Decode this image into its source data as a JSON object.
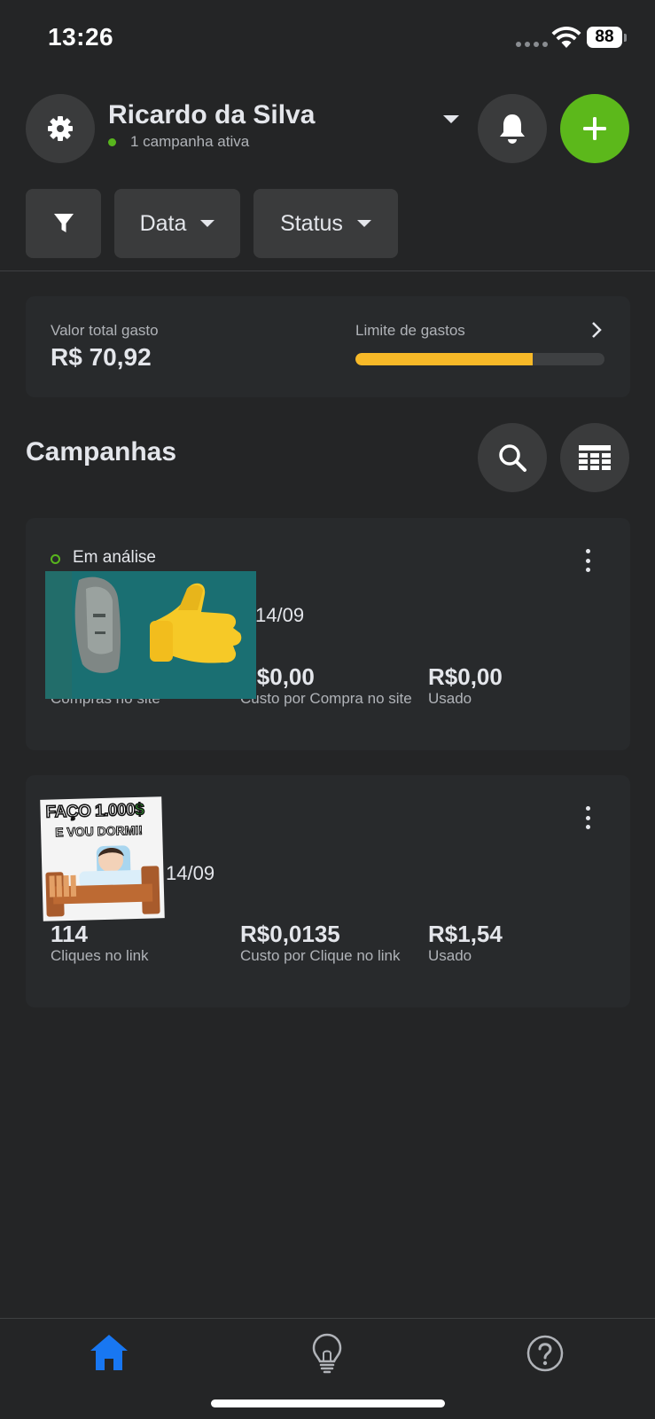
{
  "status_bar": {
    "time": "13:26",
    "battery": "88"
  },
  "header": {
    "account_name": "Ricardo da Silva",
    "active_campaigns": "1 campanha ativa"
  },
  "filters": {
    "date_label": "Data",
    "status_label": "Status"
  },
  "spend": {
    "total_label": "Valor total gasto",
    "total_value": "R$ 70,92",
    "limit_label": "Limite de gastos",
    "limit_progress_fraction": 0.71,
    "limit_color": "#f7b928"
  },
  "campaigns": {
    "title": "Campanhas",
    "items": [
      {
        "status": "Em análise",
        "date": "14/09",
        "metrics": [
          {
            "value": "",
            "label": "Compras no site"
          },
          {
            "value": "R$0,00",
            "label": "Custo por Compra no site"
          },
          {
            "value": "R$0,00",
            "label": "Usado"
          }
        ]
      },
      {
        "status": "",
        "date": "14/09",
        "thumbnail_text_1": "FAÇO 1.000",
        "thumbnail_currency": "$",
        "thumbnail_text_2": "E VOU DORMI!",
        "metrics": [
          {
            "value": "114",
            "label": "Cliques no link"
          },
          {
            "value": "R$0,0135",
            "label": "Custo por Clique no link"
          },
          {
            "value": "R$1,54",
            "label": "Usado"
          }
        ]
      }
    ]
  },
  "colors": {
    "background": "#242526",
    "surface": "#3a3b3c",
    "accent_green": "#5cb81b",
    "nav_active": "#1877f2"
  },
  "bottom_nav": {
    "items": [
      "home-icon",
      "lightbulb-icon",
      "help-icon"
    ]
  }
}
